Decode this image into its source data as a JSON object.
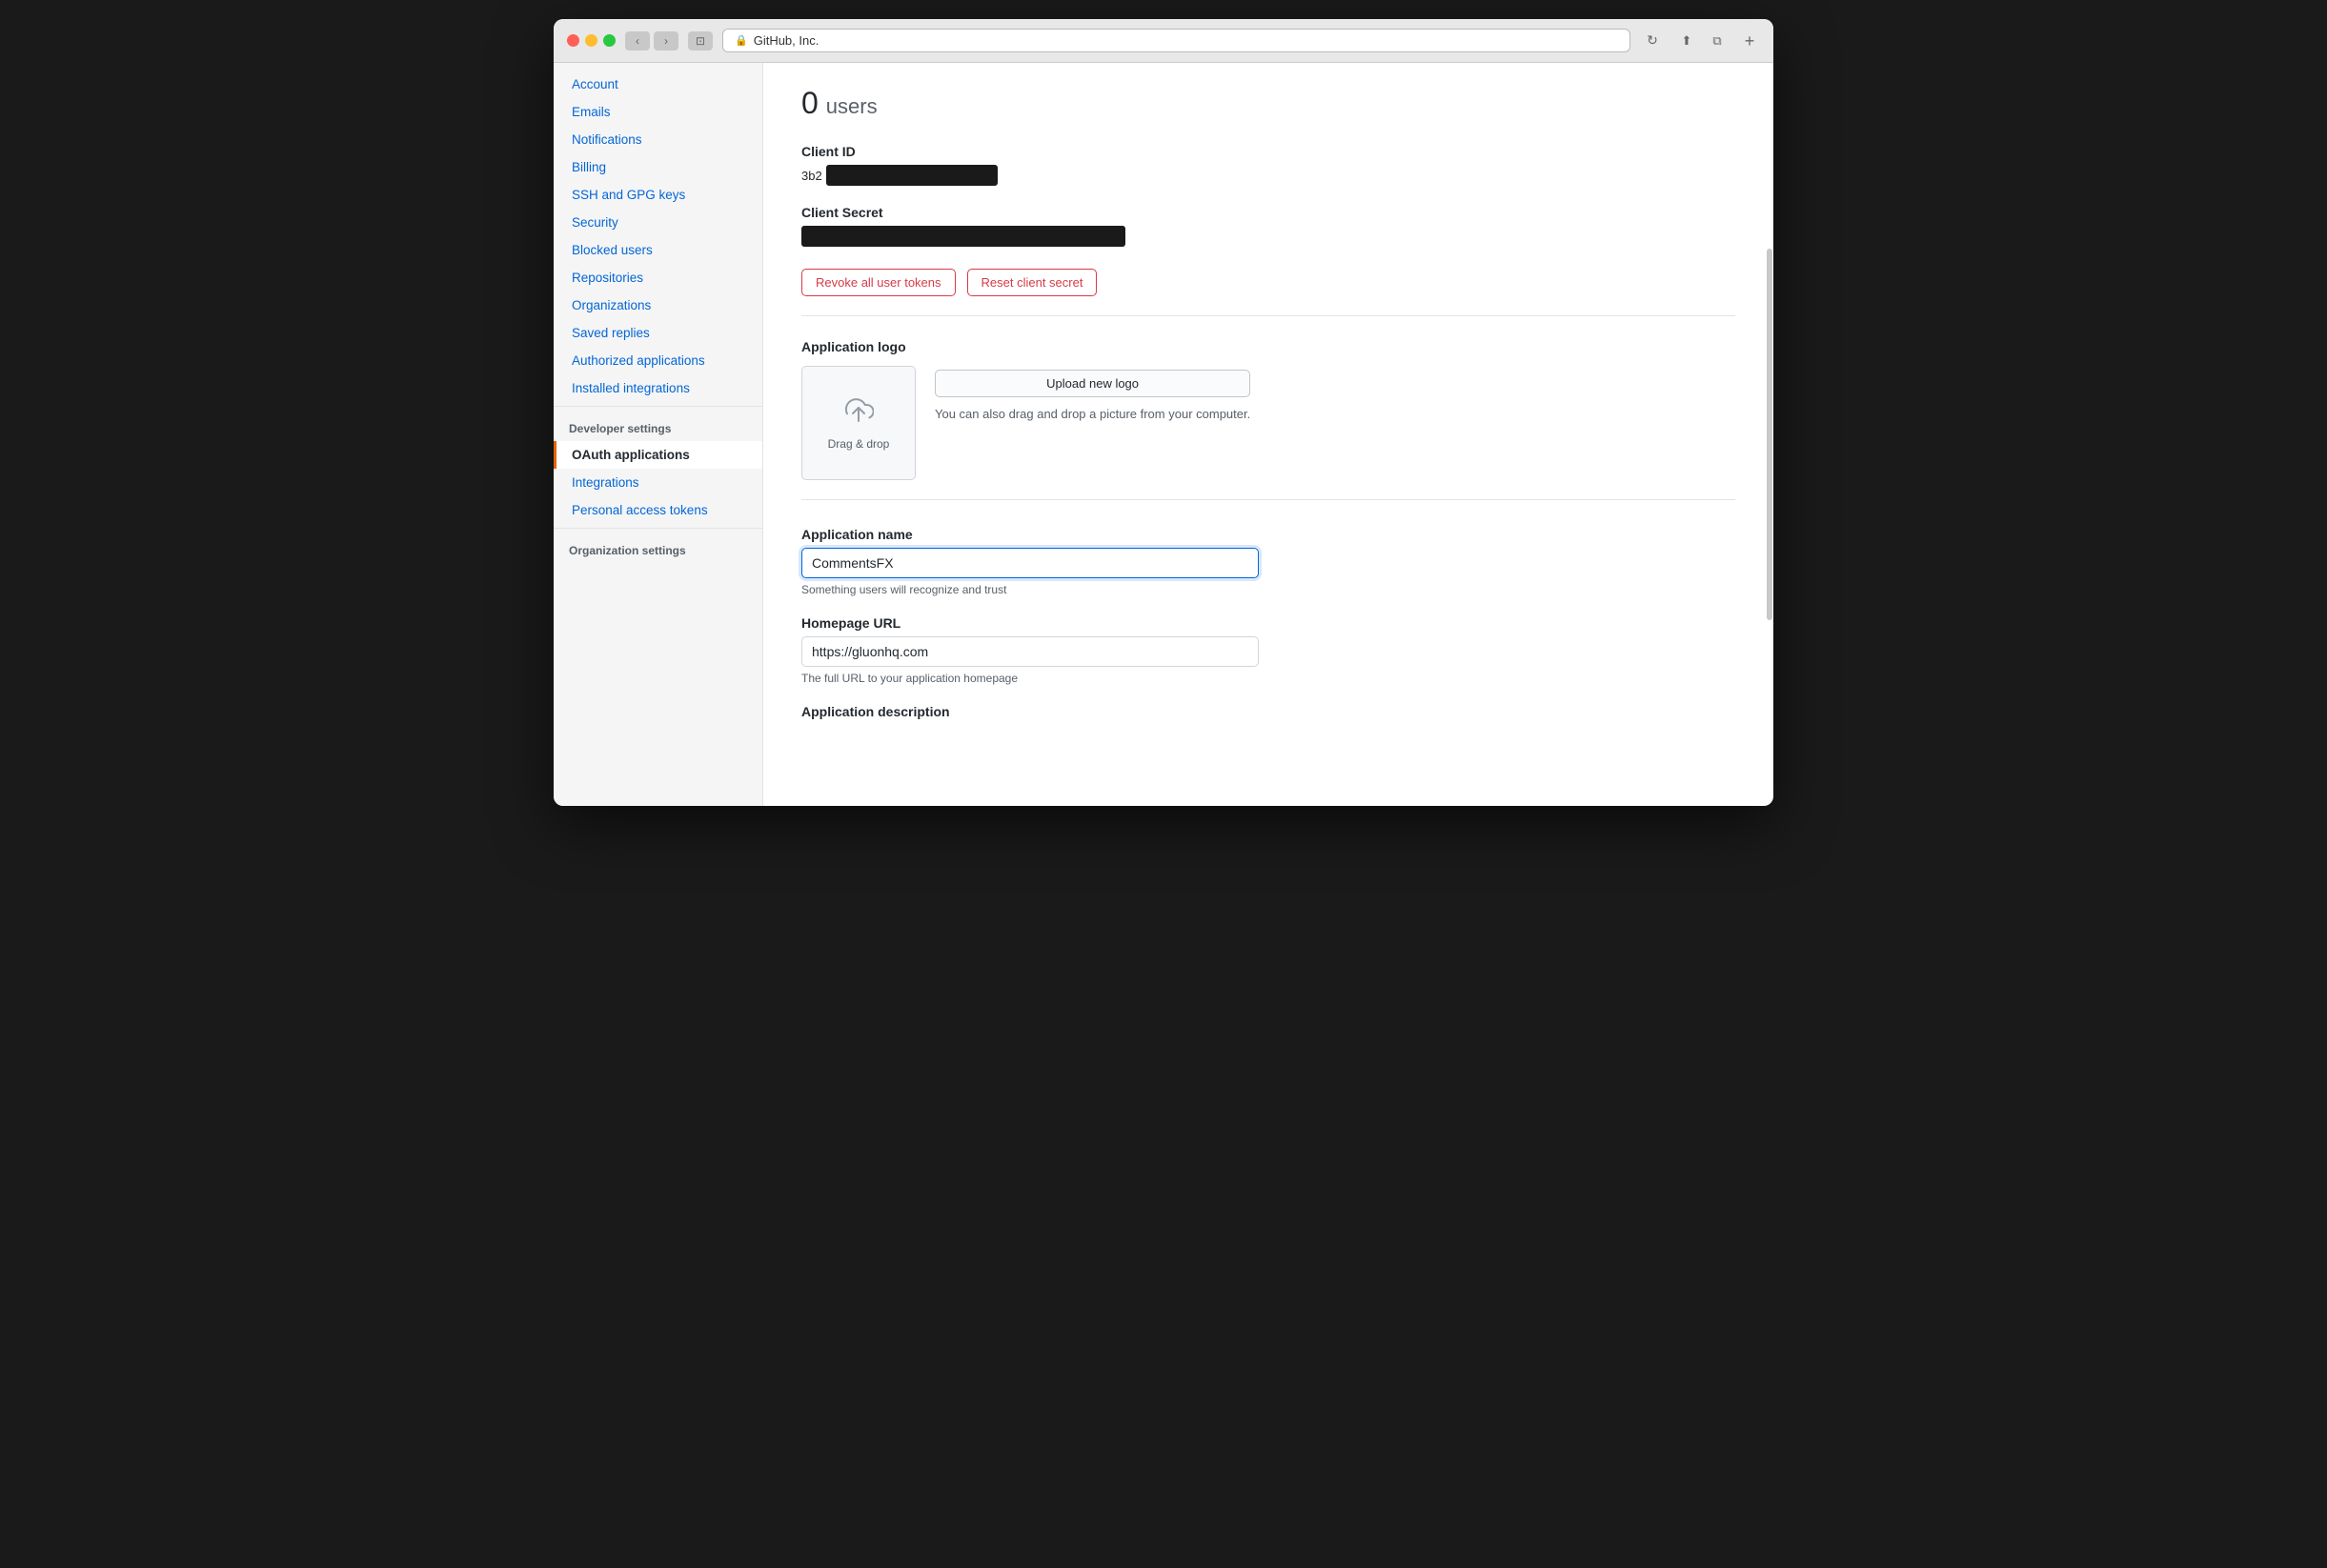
{
  "browser": {
    "url": "GitHub, Inc.",
    "url_icon": "🔒"
  },
  "sidebar": {
    "main_items": [
      {
        "id": "account",
        "label": "Account",
        "active": false
      },
      {
        "id": "emails",
        "label": "Emails",
        "active": false
      },
      {
        "id": "notifications",
        "label": "Notifications",
        "active": false
      },
      {
        "id": "billing",
        "label": "Billing",
        "active": false
      },
      {
        "id": "ssh-gpg",
        "label": "SSH and GPG keys",
        "active": false
      },
      {
        "id": "security",
        "label": "Security",
        "active": false
      },
      {
        "id": "blocked-users",
        "label": "Blocked users",
        "active": false
      },
      {
        "id": "repositories",
        "label": "Repositories",
        "active": false
      },
      {
        "id": "organizations",
        "label": "Organizations",
        "active": false
      },
      {
        "id": "saved-replies",
        "label": "Saved replies",
        "active": false
      },
      {
        "id": "authorized-apps",
        "label": "Authorized applications",
        "active": false
      },
      {
        "id": "installed-integrations",
        "label": "Installed integrations",
        "active": false
      }
    ],
    "developer_section": "Developer settings",
    "developer_items": [
      {
        "id": "oauth-apps",
        "label": "OAuth applications",
        "active": true
      },
      {
        "id": "integrations",
        "label": "Integrations",
        "active": false
      },
      {
        "id": "personal-tokens",
        "label": "Personal access tokens",
        "active": false
      }
    ],
    "org_section": "Organization settings"
  },
  "main": {
    "users_count": "0",
    "users_label": "users",
    "client_id_label": "Client ID",
    "client_id_prefix": "3b2",
    "client_secret_label": "Client Secret",
    "revoke_btn": "Revoke all user tokens",
    "reset_btn": "Reset client secret",
    "app_logo_label": "Application logo",
    "upload_btn": "Upload new logo",
    "drag_drop_text": "Drag & drop",
    "logo_hint": "You can also drag and drop a picture from your computer.",
    "app_name_label": "Application name",
    "app_name_value": "CommentsFX",
    "app_name_hint": "Something users will recognize and trust",
    "homepage_url_label": "Homepage URL",
    "homepage_url_value": "https://gluonhq.com",
    "homepage_url_hint": "The full URL to your application homepage",
    "app_description_label": "Application description"
  }
}
